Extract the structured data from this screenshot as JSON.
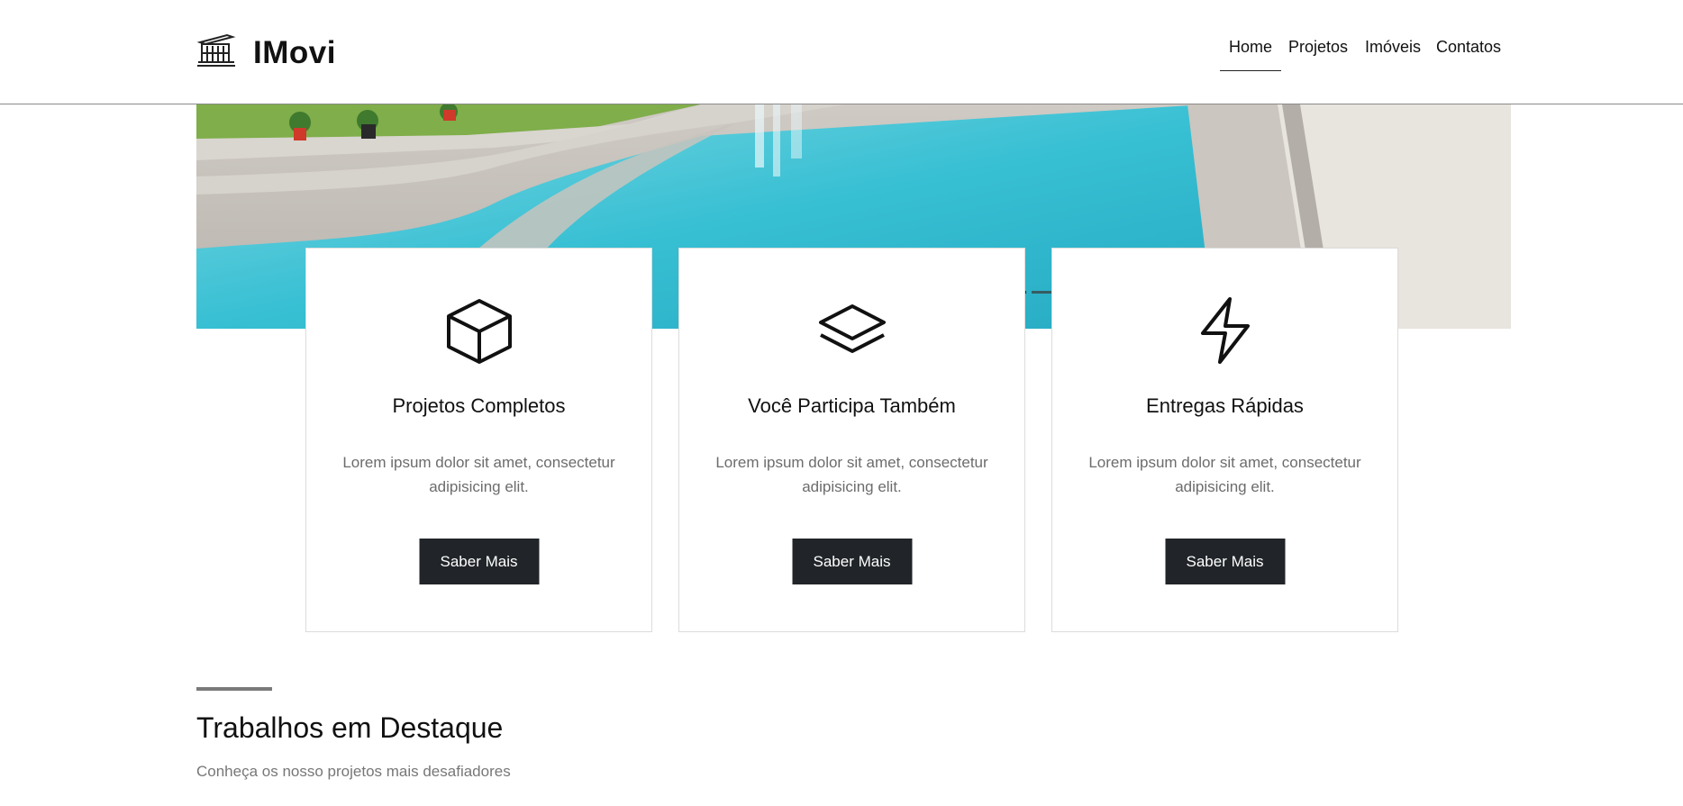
{
  "brand": {
    "name": "IMovi",
    "logo_icon": "building-icon"
  },
  "nav": {
    "items": [
      {
        "label": "Home",
        "active": true
      },
      {
        "label": "Projetos",
        "active": false
      },
      {
        "label": "Imóveis",
        "active": false
      },
      {
        "label": "Contatos",
        "active": false
      }
    ]
  },
  "carousel": {
    "slide_count": 3,
    "active_index": 0
  },
  "features": [
    {
      "icon": "box-icon",
      "title": "Projetos Completos",
      "text": "Lorem ipsum dolor sit amet, consectetur adipisicing elit.",
      "button": "Saber Mais"
    },
    {
      "icon": "layers-icon",
      "title": "Você Participa Também",
      "text": "Lorem ipsum dolor sit amet, consectetur adipisicing elit.",
      "button": "Saber Mais"
    },
    {
      "icon": "lightning-icon",
      "title": "Entregas Rápidas",
      "text": "Lorem ipsum dolor sit amet, consectetur adipisicing elit.",
      "button": "Saber Mais"
    }
  ],
  "featured": {
    "title": "Trabalhos em Destaque",
    "subtitle": "Conheça os nosso projetos mais desafiadores"
  },
  "colors": {
    "button_bg": "#212529",
    "pool": "#3fc3d6",
    "text_muted": "#6c6c6c"
  }
}
